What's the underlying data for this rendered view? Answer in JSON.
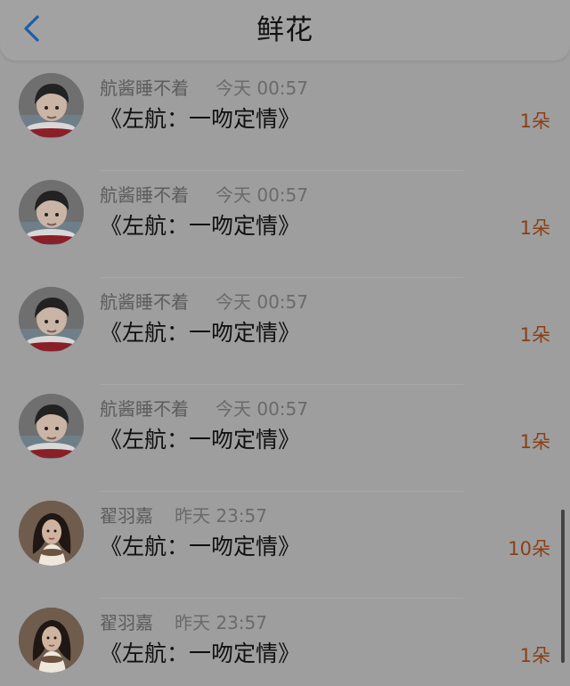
{
  "header": {
    "title": "鲜花",
    "back_icon": "chevron-left-icon",
    "accent_color": "#1f5ea6"
  },
  "items": [
    {
      "sender": "航酱睡不着",
      "time": "今天 00:57",
      "title": "《左航：一吻定情》",
      "count": "1朵",
      "avatar": "avatar-boy"
    },
    {
      "sender": "航酱睡不着",
      "time": "今天 00:57",
      "title": "《左航：一吻定情》",
      "count": "1朵",
      "avatar": "avatar-boy"
    },
    {
      "sender": "航酱睡不着",
      "time": "今天 00:57",
      "title": "《左航：一吻定情》",
      "count": "1朵",
      "avatar": "avatar-boy"
    },
    {
      "sender": "航酱睡不着",
      "time": "今天 00:57",
      "title": "《左航：一吻定情》",
      "count": "1朵",
      "avatar": "avatar-boy"
    },
    {
      "sender": "翟羽嘉",
      "time": "昨天 23:57",
      "title": "《左航：一吻定情》",
      "count": "10朵",
      "avatar": "avatar-girl"
    },
    {
      "sender": "翟羽嘉",
      "time": "昨天 23:57",
      "title": "《左航：一吻定情》",
      "count": "1朵",
      "avatar": "avatar-girl"
    }
  ],
  "colors": {
    "count": "#8b3f16",
    "text": "#101010",
    "meta": "#5c5c5c"
  }
}
